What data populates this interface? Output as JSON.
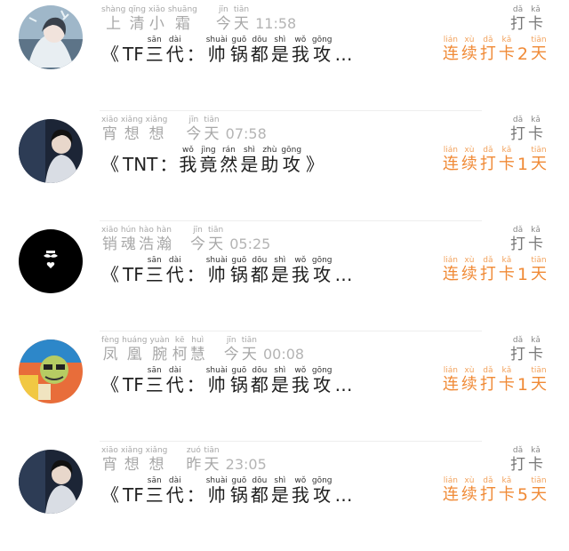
{
  "colors": {
    "accent": "#f08a36",
    "muted": "#a8a8a8"
  },
  "entries": [
    {
      "avatar": "anime-girl-avatar",
      "name": [
        [
          "shàng",
          "上"
        ],
        [
          "qīng",
          "清"
        ],
        [
          "xiǎo",
          "小"
        ],
        [
          "shuāng",
          "霜"
        ]
      ],
      "day": [
        [
          "jīn",
          "今"
        ],
        [
          "tiān",
          "天"
        ]
      ],
      "time": "11:58",
      "action": [
        [
          "dǎ",
          "打"
        ],
        [
          "kǎ",
          "卡"
        ]
      ],
      "msg_prefix": "TF",
      "msg": [
        [
          "sān",
          "三"
        ],
        [
          "dài",
          "代"
        ]
      ],
      "msg_colon": "：",
      "msg2": [
        [
          "shuài",
          "帅"
        ],
        [
          "guō",
          "锅"
        ],
        [
          "dōu",
          "都"
        ],
        [
          "shì",
          "是"
        ],
        [
          "wǒ",
          "我"
        ],
        [
          "gōng",
          "攻"
        ]
      ],
      "msg_suffix": "…",
      "streak_a": [
        [
          "lián",
          "连"
        ],
        [
          "xù",
          "续"
        ],
        [
          "dǎ",
          "打"
        ],
        [
          "kǎ",
          "卡"
        ]
      ],
      "streak_num": "2",
      "streak_b": [
        [
          "tiān",
          "天"
        ]
      ]
    },
    {
      "avatar": "dark-portrait-avatar",
      "name": [
        [
          "xiāo",
          "宵"
        ],
        [
          "xiǎng",
          "想"
        ],
        [
          "xiǎng",
          "想"
        ]
      ],
      "day": [
        [
          "jīn",
          "今"
        ],
        [
          "tiān",
          "天"
        ]
      ],
      "time": "07:58",
      "action": [
        [
          "dǎ",
          "打"
        ],
        [
          "kǎ",
          "卡"
        ]
      ],
      "msg_prefix": "TNT",
      "msg": [],
      "msg_colon": "：",
      "msg2": [
        [
          "wǒ",
          "我"
        ],
        [
          "jìng",
          "竟"
        ],
        [
          "rán",
          "然"
        ],
        [
          "shì",
          "是"
        ],
        [
          "zhù",
          "助"
        ],
        [
          "gōng",
          "攻"
        ]
      ],
      "msg_suffix": "》",
      "streak_a": [
        [
          "lián",
          "连"
        ],
        [
          "xù",
          "续"
        ],
        [
          "dǎ",
          "打"
        ],
        [
          "kǎ",
          "卡"
        ]
      ],
      "streak_num": "1",
      "streak_b": [
        [
          "tiān",
          "天"
        ]
      ]
    },
    {
      "avatar": "black-mustache-avatar",
      "name": [
        [
          "xiāo",
          "销"
        ],
        [
          "hún",
          "魂"
        ],
        [
          "hào",
          "浩"
        ],
        [
          "hàn",
          "瀚"
        ]
      ],
      "day": [
        [
          "jīn",
          "今"
        ],
        [
          "tiān",
          "天"
        ]
      ],
      "time": "05:25",
      "action": [
        [
          "dǎ",
          "打"
        ],
        [
          "kǎ",
          "卡"
        ]
      ],
      "msg_prefix": "TF",
      "msg": [
        [
          "sān",
          "三"
        ],
        [
          "dài",
          "代"
        ]
      ],
      "msg_colon": "：",
      "msg2": [
        [
          "shuài",
          "帅"
        ],
        [
          "guō",
          "锅"
        ],
        [
          "dōu",
          "都"
        ],
        [
          "shì",
          "是"
        ],
        [
          "wǒ",
          "我"
        ],
        [
          "gōng",
          "攻"
        ]
      ],
      "msg_suffix": "…",
      "streak_a": [
        [
          "lián",
          "连"
        ],
        [
          "xù",
          "续"
        ],
        [
          "dǎ",
          "打"
        ],
        [
          "kǎ",
          "卡"
        ]
      ],
      "streak_num": "1",
      "streak_b": [
        [
          "tiān",
          "天"
        ]
      ]
    },
    {
      "avatar": "cartoon-character-avatar",
      "name": [
        [
          "fèng",
          "凤"
        ],
        [
          "huáng",
          "凰"
        ],
        [
          "yuàn",
          "腕"
        ],
        [
          "kē",
          "柯"
        ],
        [
          "huì",
          "慧"
        ]
      ],
      "day": [
        [
          "jīn",
          "今"
        ],
        [
          "tiān",
          "天"
        ]
      ],
      "time": "00:08",
      "action": [
        [
          "dǎ",
          "打"
        ],
        [
          "kǎ",
          "卡"
        ]
      ],
      "msg_prefix": "TF",
      "msg": [
        [
          "sān",
          "三"
        ],
        [
          "dài",
          "代"
        ]
      ],
      "msg_colon": "：",
      "msg2": [
        [
          "shuài",
          "帅"
        ],
        [
          "guō",
          "锅"
        ],
        [
          "dōu",
          "都"
        ],
        [
          "shì",
          "是"
        ],
        [
          "wǒ",
          "我"
        ],
        [
          "gōng",
          "攻"
        ]
      ],
      "msg_suffix": "…",
      "streak_a": [
        [
          "lián",
          "连"
        ],
        [
          "xù",
          "续"
        ],
        [
          "dǎ",
          "打"
        ],
        [
          "kǎ",
          "卡"
        ]
      ],
      "streak_num": "1",
      "streak_b": [
        [
          "tiān",
          "天"
        ]
      ]
    },
    {
      "avatar": "dark-portrait-avatar",
      "name": [
        [
          "xiāo",
          "宵"
        ],
        [
          "xiǎng",
          "想"
        ],
        [
          "xiǎng",
          "想"
        ]
      ],
      "day": [
        [
          "zuó",
          "昨"
        ],
        [
          "tiān",
          "天"
        ]
      ],
      "time": "23:05",
      "action": [
        [
          "dǎ",
          "打"
        ],
        [
          "kǎ",
          "卡"
        ]
      ],
      "msg_prefix": "TF",
      "msg": [
        [
          "sān",
          "三"
        ],
        [
          "dài",
          "代"
        ]
      ],
      "msg_colon": "：",
      "msg2": [
        [
          "shuài",
          "帅"
        ],
        [
          "guō",
          "锅"
        ],
        [
          "dōu",
          "都"
        ],
        [
          "shì",
          "是"
        ],
        [
          "wǒ",
          "我"
        ],
        [
          "gōng",
          "攻"
        ]
      ],
      "msg_suffix": "…",
      "streak_a": [
        [
          "lián",
          "连"
        ],
        [
          "xù",
          "续"
        ],
        [
          "dǎ",
          "打"
        ],
        [
          "kǎ",
          "卡"
        ]
      ],
      "streak_num": "5",
      "streak_b": [
        [
          "tiān",
          "天"
        ]
      ]
    }
  ],
  "quote_open": "《"
}
